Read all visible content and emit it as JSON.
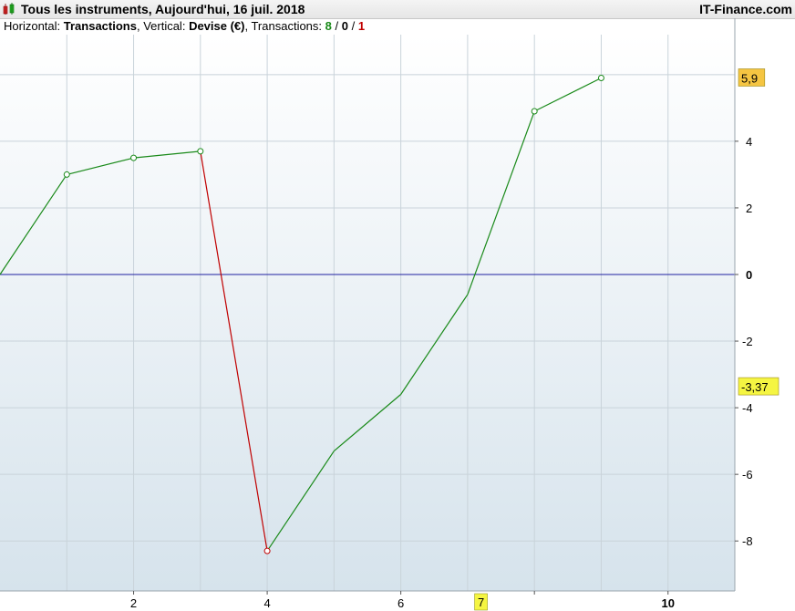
{
  "header": {
    "title": "Tous les instruments, Aujourd'hui, 16 juil. 2018",
    "brand": "IT-Finance.com",
    "icon": "candlestick-chart-icon"
  },
  "info": {
    "horizontal_label": "Horizontal:",
    "horizontal_value": "Transactions",
    "vertical_label": ", Vertical:",
    "vertical_value": "Devise (€)",
    "transactions_label": ", Transactions:",
    "count_green": "8",
    "sep1": " / ",
    "count_black": "0",
    "sep2": " / ",
    "count_red": "1"
  },
  "chart_data": {
    "type": "line",
    "xlabel": "",
    "ylabel": "",
    "xlim": [
      0,
      11
    ],
    "ylim": [
      -9.5,
      7.2
    ],
    "x_ticks": [
      2,
      4,
      6,
      8,
      10
    ],
    "x_tick_labels": [
      "2",
      "4",
      "6",
      "",
      "10"
    ],
    "y_ticks": [
      -8,
      -6,
      -4,
      -2,
      0,
      2,
      4
    ],
    "y_tick_labels": [
      "-8",
      "-6",
      "-4",
      "-2",
      "0",
      "2",
      "4"
    ],
    "grid": true,
    "zero_line_color": "#2020a0",
    "series": [
      {
        "x": [
          0,
          1,
          2,
          3,
          4,
          5,
          6,
          7,
          8,
          9
        ],
        "y": [
          0,
          3.0,
          3.5,
          3.7,
          -8.3,
          -5.3,
          -3.6,
          -0.6,
          4.9,
          5.9
        ],
        "markers": [
          false,
          true,
          true,
          true,
          true,
          false,
          false,
          false,
          true,
          true
        ],
        "segment_colors": [
          "#1a8a1a",
          "#1a8a1a",
          "#1a8a1a",
          "#c00000",
          "#1a8a1a",
          "#1a8a1a",
          "#1a8a1a",
          "#1a8a1a",
          "#1a8a1a"
        ]
      }
    ],
    "value_labels": [
      {
        "text": "5,9",
        "y": 5.9,
        "bg": "#f5c542"
      },
      {
        "text": "-3,37",
        "y": -3.37,
        "bg": "#f5f542"
      }
    ],
    "x_highlight": {
      "text": "7",
      "x": 7.2,
      "bg": "#f5f542"
    }
  }
}
